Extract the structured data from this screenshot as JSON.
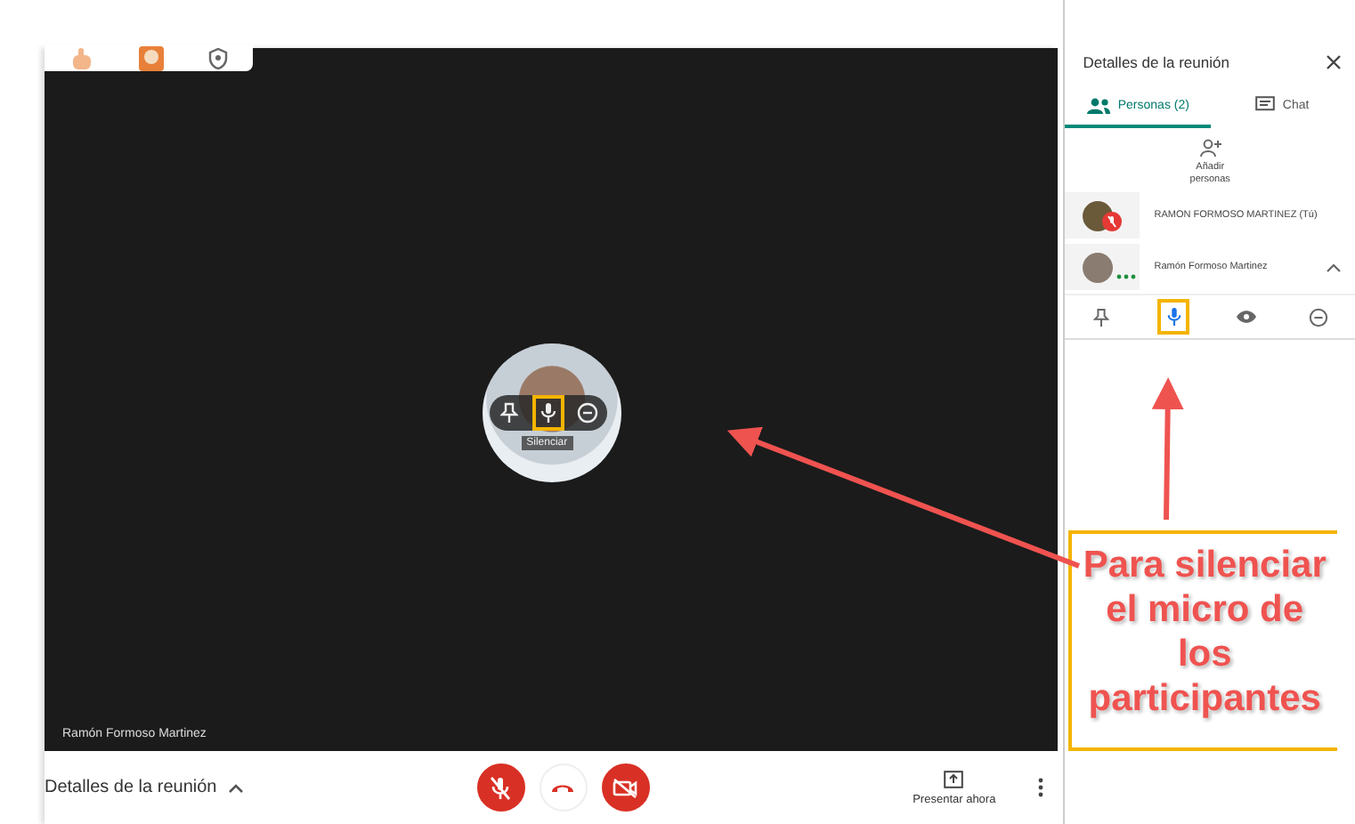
{
  "video": {
    "participant_name": "Ramón Formoso Martinez",
    "tooltip": "Silenciar"
  },
  "side_panel": {
    "title": "Detalles de la reunión",
    "tabs": [
      {
        "label": "Personas (2)",
        "selected": true
      },
      {
        "label": "Chat",
        "selected": false
      }
    ],
    "add_people": "Añadir personas",
    "participants": [
      {
        "name": "RAMON FORMOSO MARTINEZ (Tú)",
        "muted": true,
        "expanded": false
      },
      {
        "name": "Ramón Formoso Martinez",
        "muted": false,
        "expanded": true
      }
    ]
  },
  "bottom_bar": {
    "meeting_details": "Detalles de la reunión",
    "mic_muted": true,
    "camera_off": true,
    "present": "Presentar ahora"
  },
  "callout": "Para silenciar el micro de los participantes"
}
